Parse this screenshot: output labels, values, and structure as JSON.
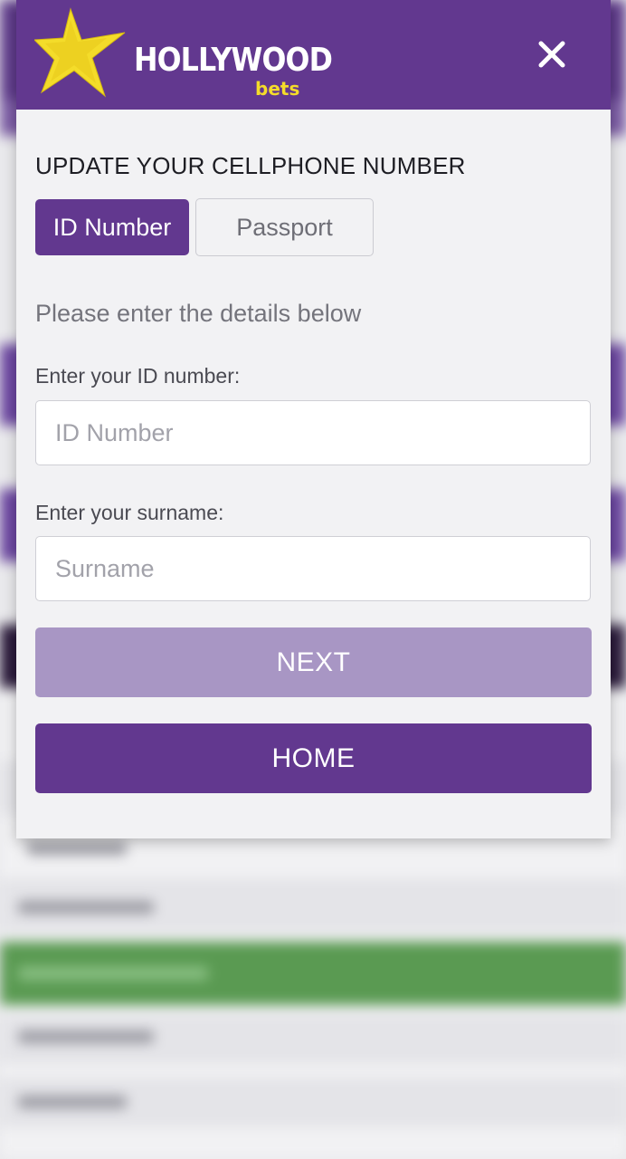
{
  "brand": {
    "name": "HOLLYWOOD",
    "sub": "bets",
    "colors": {
      "primary": "#62388f",
      "star": "#f4dc2a",
      "next_disabled": "#a896c4"
    }
  },
  "modal": {
    "title": "UPDATE YOUR CELLPHONE NUMBER",
    "close_icon": "close-icon",
    "tabs": [
      {
        "label": "ID Number",
        "active": true
      },
      {
        "label": "Passport",
        "active": false
      }
    ],
    "subtitle": "Please enter the details below",
    "id_field": {
      "label": "Enter your ID number:",
      "placeholder": "ID Number",
      "value": ""
    },
    "surname_field": {
      "label": "Enter your surname:",
      "placeholder": "Surname",
      "value": ""
    },
    "next_label": "NEXT",
    "home_label": "HOME"
  }
}
